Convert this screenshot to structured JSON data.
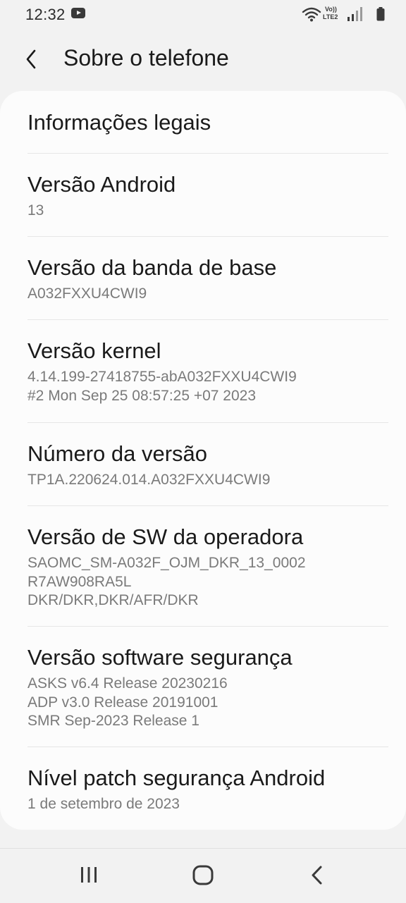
{
  "status_bar": {
    "time": "12:32",
    "volte_top": "Vo))",
    "volte_bottom": "LTE2"
  },
  "header": {
    "title": "Sobre o telefone"
  },
  "items": [
    {
      "title": "Informações legais",
      "subtitle": ""
    },
    {
      "title": "Versão Android",
      "subtitle": "13"
    },
    {
      "title": "Versão da banda de base",
      "subtitle": "A032FXXU4CWI9"
    },
    {
      "title": "Versão kernel",
      "subtitle": "4.14.199-27418755-abA032FXXU4CWI9\n#2 Mon Sep 25 08:57:25 +07 2023"
    },
    {
      "title": "Número da versão",
      "subtitle": "TP1A.220624.014.A032FXXU4CWI9"
    },
    {
      "title": "Versão de SW da operadora",
      "subtitle": "SAOMC_SM-A032F_OJM_DKR_13_0002\nR7AW908RA5L\nDKR/DKR,DKR/AFR/DKR"
    },
    {
      "title": "Versão software segurança",
      "subtitle": "ASKS v6.4 Release 20230216\nADP v3.0 Release 20191001\nSMR Sep-2023 Release 1"
    },
    {
      "title": "Nível patch segurança Android",
      "subtitle": "1 de setembro de 2023"
    }
  ],
  "icons": {
    "status": [
      "youtube-icon",
      "wifi-icon",
      "volte-icon",
      "signal-icon",
      "battery-icon"
    ],
    "header": [
      "back-arrow-icon"
    ],
    "nav": [
      "recent-apps-icon",
      "home-icon",
      "back-icon"
    ]
  }
}
